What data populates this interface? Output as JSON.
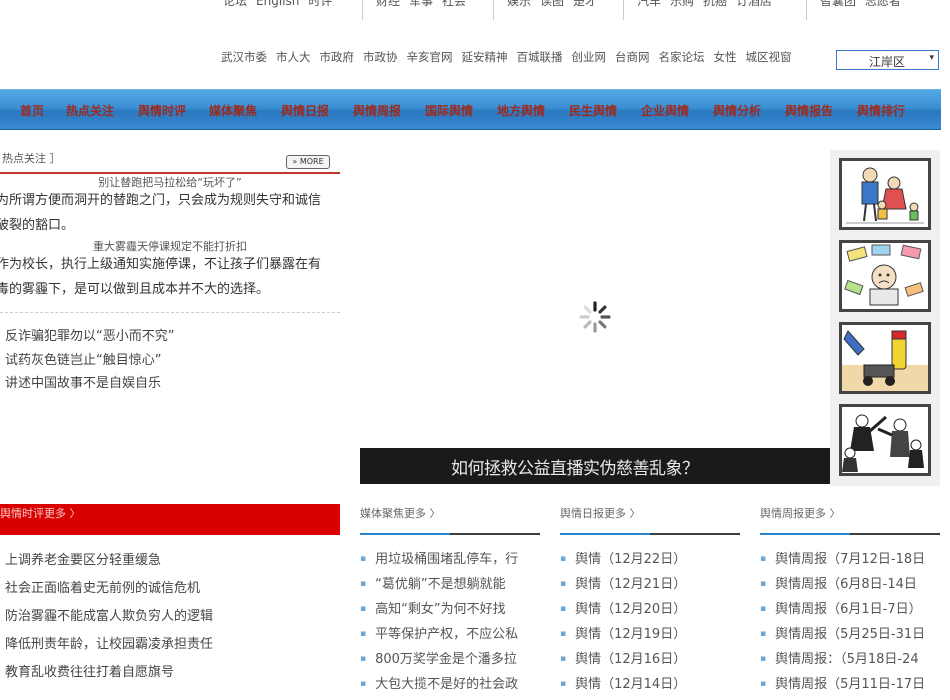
{
  "top_nav": {
    "group1": [
      "论坛",
      "English",
      "时评"
    ],
    "group2": [
      "财经",
      "军事",
      "社会"
    ],
    "group3": [
      "娱乐",
      "读图",
      "楚才"
    ],
    "group4": [
      "汽车",
      "乐购",
      "抗癌",
      "订酒店"
    ],
    "group5": [
      "智囊团",
      "志愿者"
    ]
  },
  "links": [
    "武汉市委",
    "市人大",
    "市政府",
    "市政协",
    "辛亥官网",
    "延安精神",
    "百城联播",
    "创业网",
    "台商网",
    "名家论坛",
    "女性",
    "城区视窗"
  ],
  "district_select": {
    "value": "江岸区",
    "arrow": "▾"
  },
  "main_nav": [
    "首页",
    "热点关注",
    "舆情时评",
    "媒体聚焦",
    "舆情日报",
    "舆情周报",
    "国际舆情",
    "地方舆情",
    "民生舆情",
    "企业舆情",
    "舆情分析",
    "舆情报告",
    "舆情排行"
  ],
  "hot": {
    "title": "热点关注 ］",
    "more": "» MORE",
    "articles": [
      {
        "title": "别让替跑把马拉松给“玩坏了”",
        "lines": [
          "为所谓方便而洞开的替跑之门，只会成为规则失守和诚信",
          "破裂的豁口。"
        ]
      },
      {
        "title": "重大雾霾天停课规定不能打折扣",
        "lines": [
          "作为校长，执行上级通知实施停课，不让孩子们暴露在有",
          "毒的雾霾下，是可以做到且成本并不大的选择。"
        ]
      }
    ],
    "list": [
      "反诈骗犯罪勿以“恶小而不究”",
      "试药灰色链岂止“触目惊心”",
      "讲述中国故事不是自娱自乐"
    ]
  },
  "slide": {
    "caption": "如何拯救公益直播实伪慈善乱象？"
  },
  "cartoons": [
    "family-cartoon",
    "money-cartoon",
    "lighter-cartoon",
    "crowd-cartoon"
  ],
  "sections": {
    "commentary": {
      "title": "舆情时评更多 〉",
      "items": [
        "上调养老金要区分轻重缓急",
        "社会正面临着史无前例的诚信危机",
        "防治雾霾不能成富人欺负穷人的逻辑",
        "降低刑责年龄，让校园霸凌承担责任",
        "教育乱收费往往打着自愿旗号"
      ]
    },
    "media": {
      "title": "媒体聚焦更多 〉",
      "items": [
        "用垃圾桶围堵乱停车，行",
        "“葛优躺”不是想躺就能",
        "高知“剩女”为何不好找",
        "平等保护产权，不应公私",
        "800万奖学金是个潘多拉",
        "大包大揽不是好的社会政"
      ]
    },
    "daily": {
      "title": "舆情日报更多 〉",
      "items": [
        "舆情（12月22日）",
        "舆情（12月21日）",
        "舆情（12月20日）",
        "舆情（12月19日）",
        "舆情（12月16日）",
        "舆情（12月14日）"
      ]
    },
    "weekly": {
      "title": "舆情周报更多 〉",
      "items": [
        "舆情周报（7月12日-18日",
        "舆情周报（6月8日-14日",
        "舆情周报（6月1日-7日）",
        "舆情周报（5月25日-31日",
        "舆情周报：（5月18日-24",
        "舆情周报（5月11日-17日"
      ]
    }
  }
}
